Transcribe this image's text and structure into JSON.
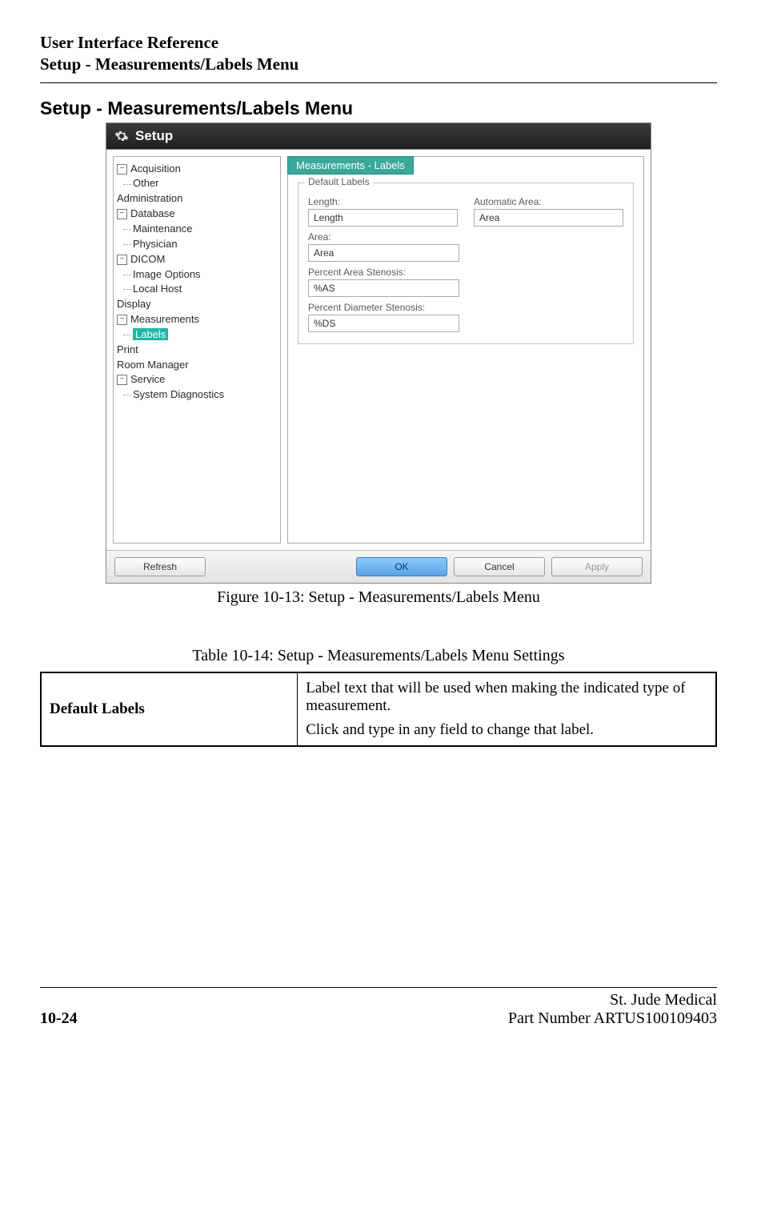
{
  "header": {
    "line1": "User Interface Reference",
    "line2": "Setup - Measurements/Labels Menu"
  },
  "section_title": "Setup - Measurements/Labels Menu",
  "screenshot": {
    "title": "Setup",
    "tree": {
      "items": [
        {
          "label": "Acquisition",
          "expand": "-"
        },
        {
          "label": "Other",
          "child": true
        },
        {
          "label": "Administration"
        },
        {
          "label": "Database",
          "expand": "-"
        },
        {
          "label": "Maintenance",
          "child": true
        },
        {
          "label": "Physician",
          "child": true
        },
        {
          "label": "DICOM",
          "expand": "-"
        },
        {
          "label": "Image Options",
          "child": true
        },
        {
          "label": "Local Host",
          "child": true
        },
        {
          "label": "Display"
        },
        {
          "label": "Measurements",
          "expand": "-"
        },
        {
          "label": "Labels",
          "child": true,
          "selected": true
        },
        {
          "label": "Print"
        },
        {
          "label": "Room Manager"
        },
        {
          "label": "Service",
          "expand": "-"
        },
        {
          "label": "System Diagnostics",
          "child": true
        }
      ]
    },
    "panel": {
      "title": "Measurements - Labels",
      "fieldset_legend": "Default Labels",
      "fields": {
        "length_label": "Length:",
        "length_value": "Length",
        "auto_area_label": "Automatic Area:",
        "auto_area_value": "Area",
        "area_label": "Area:",
        "area_value": "Area",
        "pas_label": "Percent Area Stenosis:",
        "pas_value": "%AS",
        "pds_label": "Percent Diameter Stenosis:",
        "pds_value": "%DS"
      }
    },
    "buttons": {
      "refresh": "Refresh",
      "ok": "OK",
      "cancel": "Cancel",
      "apply": "Apply"
    }
  },
  "figure_caption": "Figure 10-13:  Setup - Measurements/Labels Menu",
  "table_caption": "Table 10-14:  Setup - Measurements/Labels Menu Settings",
  "table": {
    "row1_left": "Default Labels",
    "row1_right_p1": "Label text that will be used when making the indi­cated type of measurement.",
    "row1_right_p2": "Click and type in any field to change that label."
  },
  "footer": {
    "page": "10-24",
    "company": "St. Jude Medical",
    "part": "Part Number ARTUS100109403"
  }
}
